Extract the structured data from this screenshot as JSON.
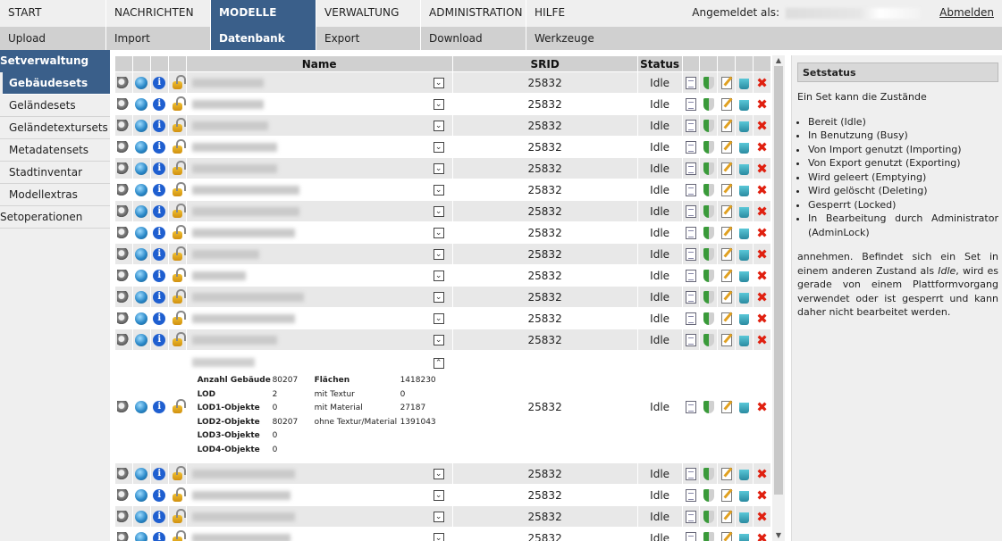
{
  "nav": {
    "top": [
      "START",
      "NACHRICHTEN",
      "MODELLE",
      "VERWALTUNG",
      "ADMINISTRATION",
      "HILFE"
    ],
    "sub": [
      "Upload",
      "Import",
      "Datenbank",
      "Export",
      "Download",
      "Werkzeuge"
    ],
    "login_label": "Angemeldet als:",
    "logout": "Abmelden"
  },
  "sidebar": {
    "title": "Setverwaltung",
    "items": [
      "Gebäudesets",
      "Geländesets",
      "Geländetextursets",
      "Metadatensets",
      "Stadtinventar",
      "Modellextras"
    ],
    "footer": "Setoperationen"
  },
  "table": {
    "headers": {
      "name": "Name",
      "srid": "SRID",
      "status": "Status"
    },
    "rows": [
      {
        "srid": "25832",
        "status": "Idle"
      },
      {
        "srid": "25832",
        "status": "Idle"
      },
      {
        "srid": "25832",
        "status": "Idle"
      },
      {
        "srid": "25832",
        "status": "Idle"
      },
      {
        "srid": "25832",
        "status": "Idle"
      },
      {
        "srid": "25832",
        "status": "Idle"
      },
      {
        "srid": "25832",
        "status": "Idle"
      },
      {
        "srid": "25832",
        "status": "Idle"
      },
      {
        "srid": "25832",
        "status": "Idle"
      },
      {
        "srid": "25832",
        "status": "Idle"
      },
      {
        "srid": "25832",
        "status": "Idle"
      },
      {
        "srid": "25832",
        "status": "Idle"
      },
      {
        "srid": "25832",
        "status": "Idle"
      }
    ],
    "expanded": {
      "srid": "25832",
      "status": "Idle",
      "stats": [
        {
          "label": "Anzahl Gebäude",
          "value": "80207"
        },
        {
          "label": "LOD",
          "value": "2"
        },
        {
          "label": "LOD1-Objekte",
          "value": "0"
        },
        {
          "label": "LOD2-Objekte",
          "value": "80207"
        },
        {
          "label": "LOD3-Objekte",
          "value": "0"
        },
        {
          "label": "LOD4-Objekte",
          "value": "0"
        }
      ],
      "stats2": [
        {
          "label": "Flächen",
          "value": "1418230"
        },
        {
          "label": "mit Textur",
          "value": "0"
        },
        {
          "label": "mit Material",
          "value": "27187"
        },
        {
          "label": "ohne Textur/Material",
          "value": "1391043"
        }
      ]
    },
    "rows_after": [
      {
        "srid": "25832",
        "status": "Idle"
      },
      {
        "srid": "25832",
        "status": "Idle"
      },
      {
        "srid": "25832",
        "status": "Idle"
      },
      {
        "srid": "25832",
        "status": "Idle"
      }
    ]
  },
  "panel": {
    "title": "Setstatus",
    "intro": "Ein Set kann die Zustände",
    "states": [
      "Bereit (Idle)",
      "In Benutzung (Busy)",
      "Von Import genutzt (Importing)",
      "Von Export genutzt (Exporting)",
      "Wird geleert (Emptying)",
      "Wird gelöscht (Deleting)",
      "Gesperrt (Locked)",
      "In Bearbeitung durch Administrator (AdminLock)"
    ],
    "text_before": "annehmen. Befindet sich ein Set in einem anderen Zustand als ",
    "text_em": "Idle",
    "text_after": ", wird es gerade von einem Plattformvorgang verwendet oder ist gesperrt und kann daher nicht bearbeitet werden."
  },
  "icons": [
    "wrench-icon",
    "globe-icon",
    "info-icon",
    "lock-icon",
    "document-icon",
    "shield-icon",
    "edit-icon",
    "trash-icon",
    "delete-icon",
    "expand-icon"
  ],
  "colors": {
    "accent": "#3a5f8a",
    "delete": "#e02010"
  }
}
